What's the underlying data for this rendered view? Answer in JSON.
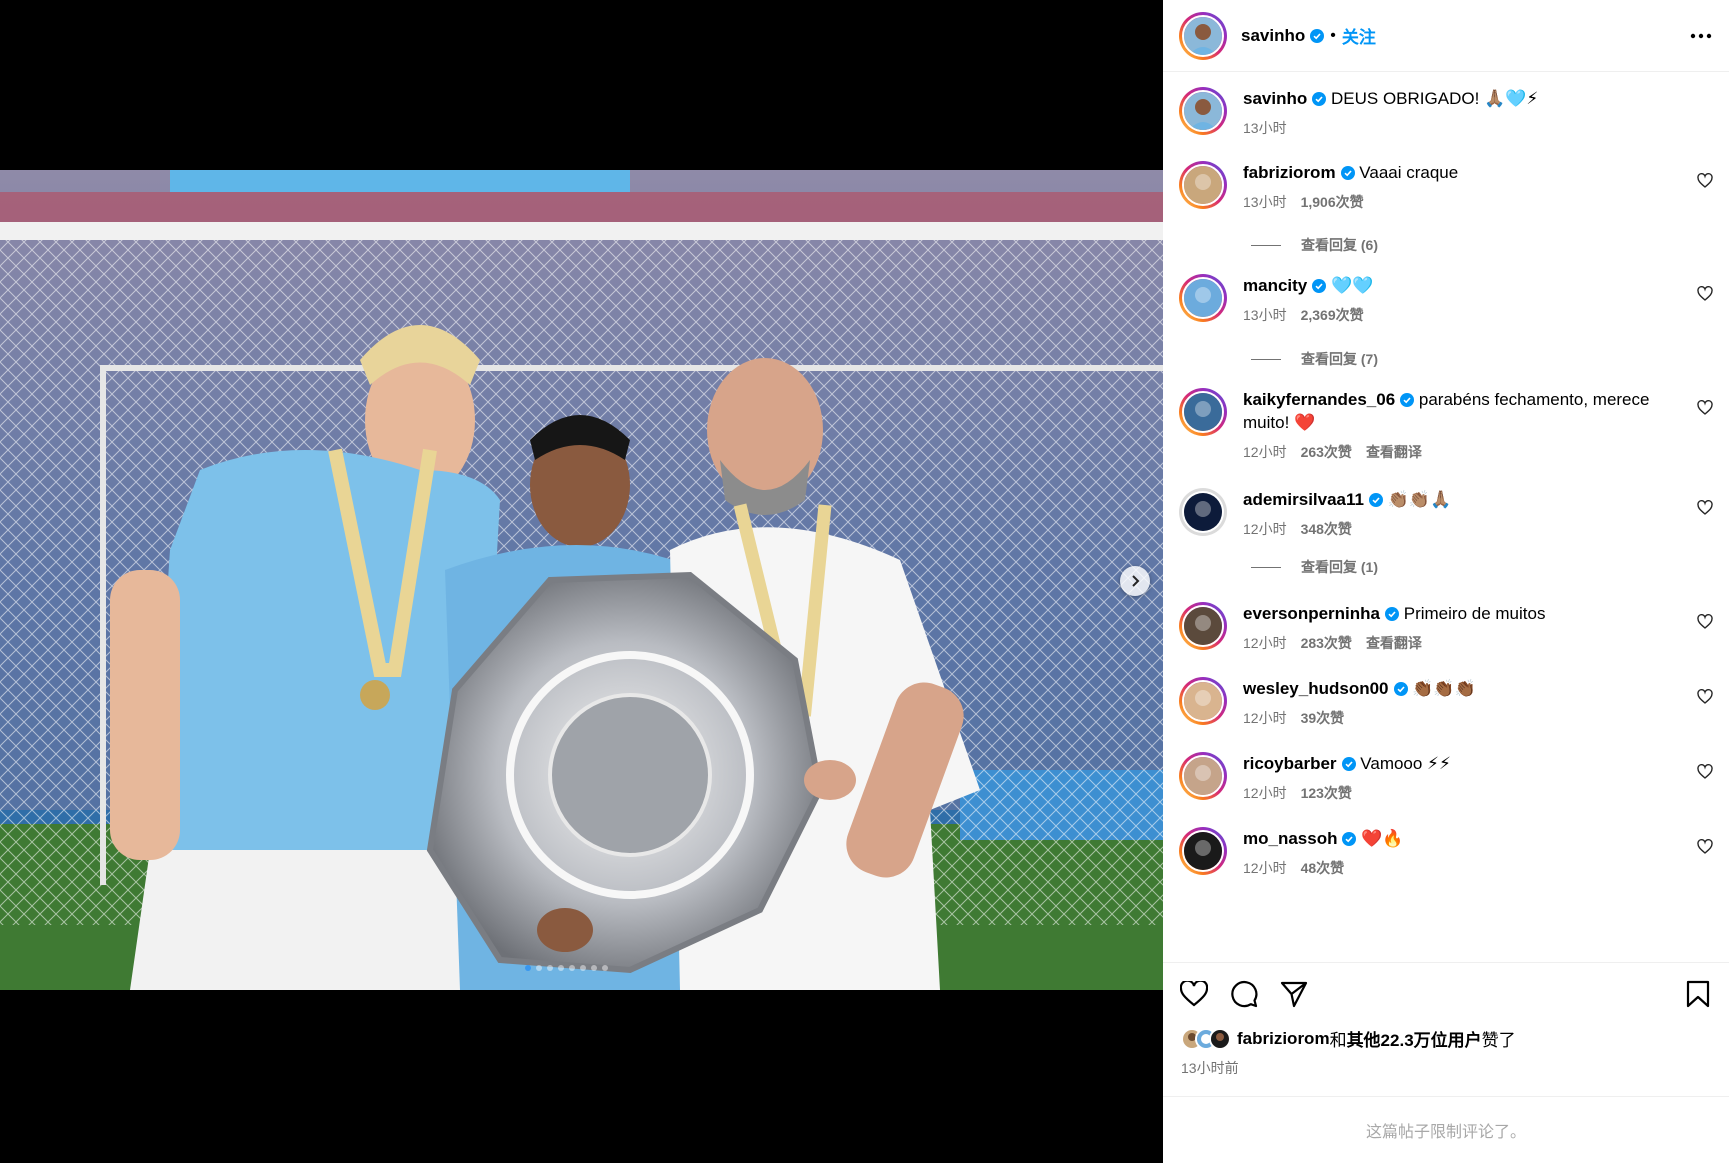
{
  "header": {
    "username": "savinho",
    "dot": "•",
    "follow_label": "关注"
  },
  "caption": {
    "username": "savinho",
    "text": "DEUS OBRIGADO! 🙏🏽🩵⚡",
    "time": "13小时"
  },
  "comments": [
    {
      "username": "fabriziorom",
      "text": "Vaaai craque",
      "time": "13小时",
      "likes": "1,906次赞",
      "translate": "",
      "replies": "查看回复 (6)",
      "avatar_color": "#c9a77c"
    },
    {
      "username": "mancity",
      "text": "🩵🩵",
      "time": "13小时",
      "likes": "2,369次赞",
      "translate": "",
      "replies": "查看回复 (7)",
      "avatar_color": "#6cabdd"
    },
    {
      "username": "kaikyfernandes_06",
      "text": "parabéns fechamento, merece muito! ❤️",
      "time": "12小时",
      "likes": "263次赞",
      "translate": "查看翻译",
      "replies": "",
      "avatar_color": "#3a6b9a"
    },
    {
      "username": "ademirsilvaa11",
      "text": "👏🏽👏🏽🙏🏽",
      "time": "12小时",
      "likes": "348次赞",
      "translate": "",
      "replies": "查看回复 (1)",
      "avatar_color": "#0d1b3a"
    },
    {
      "username": "eversonperninha",
      "text": "Primeiro de muitos",
      "time": "12小时",
      "likes": "283次赞",
      "translate": "查看翻译",
      "replies": "",
      "avatar_color": "#5b4a3c"
    },
    {
      "username": "wesley_hudson00",
      "text": "👏🏾👏🏾👏🏾",
      "time": "12小时",
      "likes": "39次赞",
      "translate": "",
      "replies": "",
      "avatar_color": "#d9b48f"
    },
    {
      "username": "ricoybarber",
      "text": "Vamooo ⚡⚡",
      "time": "12小时",
      "likes": "123次赞",
      "translate": "",
      "replies": "",
      "avatar_color": "#c5a48a"
    },
    {
      "username": "mo_nassoh",
      "text": "❤️🔥",
      "time": "12小时",
      "likes": "48次赞",
      "translate": "",
      "replies": "",
      "avatar_color": "#1a1a1a"
    }
  ],
  "likes_line": {
    "user": "fabriziorom",
    "and": "和",
    "others": "其他22.3万位用户",
    "suffix": "赞了"
  },
  "post_time": "13小时前",
  "comments_limited": "这篇帖子限制评论了。",
  "icons": {
    "like": "heart-icon",
    "comment": "comment-icon",
    "share": "send-icon",
    "save": "bookmark-icon",
    "more": "more-icon",
    "next": "chevron-right-icon"
  },
  "colors": {
    "link": "#0095f6",
    "verified": "#0095f6",
    "muted": "#737373",
    "ring_gradient": [
      "#feda75",
      "#fa7e1e",
      "#d62976",
      "#962fbf",
      "#4f5bd5"
    ]
  },
  "carousel": {
    "slide_count": 8,
    "active_index": 0
  }
}
